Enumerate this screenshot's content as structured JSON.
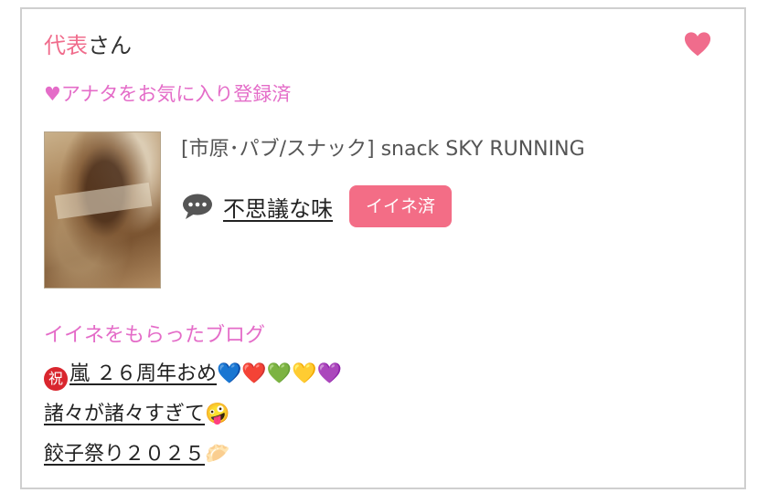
{
  "user": {
    "name": "代表",
    "suffix": "さん"
  },
  "favorite": {
    "status": "♥アナタをお気に入り登録済",
    "icon": "heart-icon"
  },
  "post": {
    "thumbnail_alt": "food photo",
    "shop": "[市原･パブ/スナック]  snack SKY RUNNING",
    "comment": "不思議な味",
    "comment_icon": "speech-bubble-icon",
    "like_button": "イイネ済"
  },
  "blogs": {
    "heading": "イイネをもらったブログ",
    "items": [
      {
        "prefix": "祝",
        "text": "嵐 ２６周年おめ",
        "emoji": "💙❤️💚💛💜"
      },
      {
        "prefix": "",
        "text": "諸々が諸々すぎて",
        "emoji": "🤪"
      },
      {
        "prefix": "",
        "text": "餃子祭り２０２５",
        "emoji": "🥟"
      }
    ]
  },
  "colors": {
    "accent_pink": "#f06c8c",
    "magenta_text": "#e46cc8",
    "like_button_bg": "#f36d86",
    "border": "#cfcfcf"
  }
}
